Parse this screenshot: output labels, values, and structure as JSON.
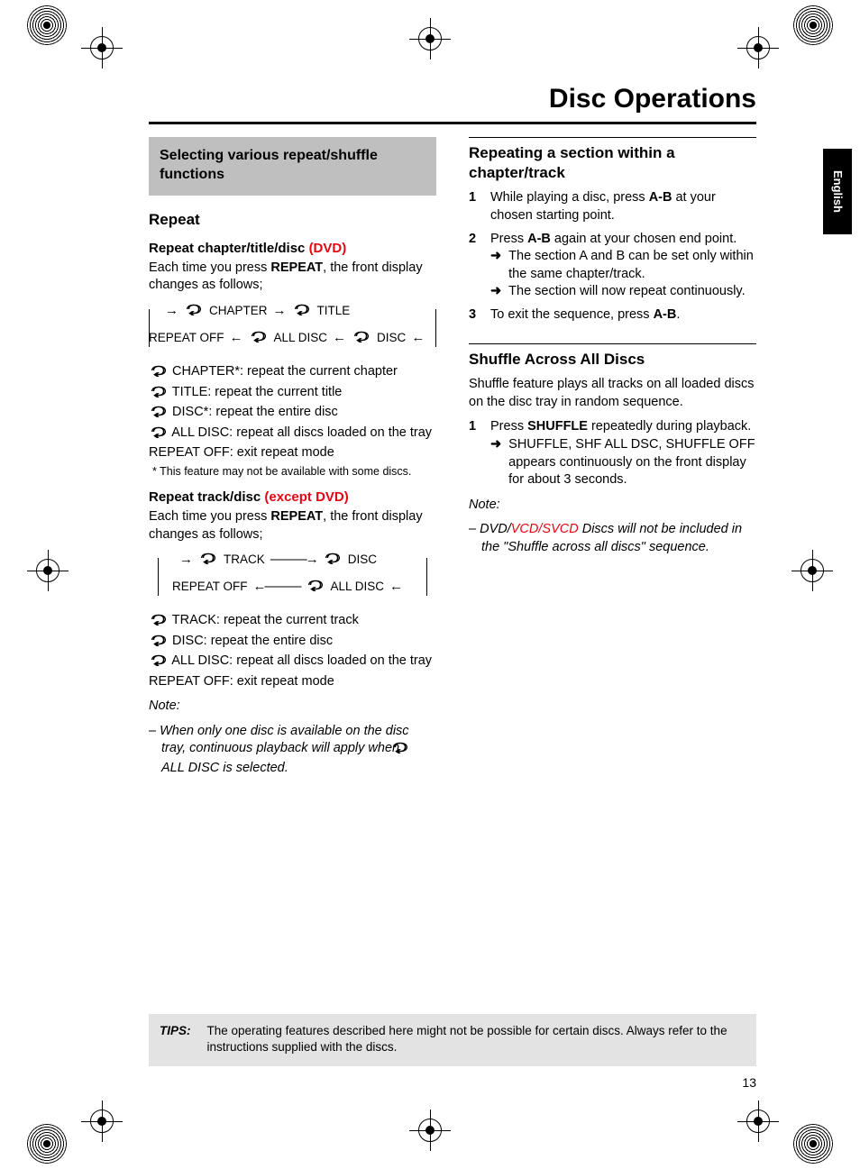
{
  "page_title": "Disc Operations",
  "language_tab": "English",
  "page_number": "13",
  "tips": {
    "label": "TIPS:",
    "text": "The operating features described here might not be possible for certain discs. Always refer to the instructions supplied with the discs."
  },
  "left": {
    "box_heading": "Selecting various repeat/shuffle functions",
    "repeat_heading": "Repeat",
    "dvd": {
      "title_prefix": "Repeat chapter/title/disc ",
      "title_suffix": "(DVD)",
      "intro_a": "Each time you press ",
      "intro_b": "REPEAT",
      "intro_c": ", the front display changes as follows;",
      "seq": {
        "a": "CHAPTER",
        "b": "TITLE",
        "c": "DISC",
        "d": "ALL DISC",
        "e": "REPEAT OFF"
      },
      "defs": {
        "chapter": " CHAPTER*: repeat the current chapter",
        "title": " TITLE: repeat the current title",
        "disc": " DISC*: repeat the entire disc",
        "all": " ALL DISC: repeat all discs loaded on the tray",
        "off": "REPEAT OFF: exit repeat mode"
      },
      "footnote": "*  This feature may not be available with some discs."
    },
    "nondvd": {
      "title_prefix": "Repeat track/disc ",
      "title_suffix": "(except DVD)",
      "intro_a": "Each time you press ",
      "intro_b": "REPEAT",
      "intro_c": ", the front display changes as follows;",
      "seq": {
        "a": "TRACK",
        "b": "DISC",
        "c": "ALL DISC",
        "d": "REPEAT OFF"
      },
      "defs": {
        "track": " TRACK: repeat the current track",
        "disc": " DISC: repeat the entire disc",
        "all": " ALL DISC: repeat all discs loaded on the tray",
        "off": "REPEAT OFF: exit repeat mode"
      },
      "note_label": "Note:",
      "note_body_a": "–   When only one disc is available on the disc tray, continuous playback will apply when ",
      "note_body_b": " ALL DISC is selected."
    }
  },
  "right": {
    "ab": {
      "heading": "Repeating a section within a chapter/track",
      "s1_a": "While playing a disc, press ",
      "s1_b": "A-B",
      "s1_c": " at your chosen starting point.",
      "s2_a": "Press ",
      "s2_b": "A-B",
      "s2_c": " again at your chosen end point.",
      "s2_l1": "The section A and B can be set only within the same chapter/track.",
      "s2_l2": "The section will now repeat continuously.",
      "s3_a": "To exit the sequence, press ",
      "s3_b": "A-B",
      "s3_c": "."
    },
    "shuffle": {
      "heading": "Shuffle Across All Discs",
      "intro": "Shuffle feature plays all tracks on all loaded discs on the disc tray in random sequence.",
      "s1_a": "Press ",
      "s1_b": "SHUFFLE",
      "s1_c": " repeatedly during playback.",
      "s1_l1": "SHUFFLE, SHF ALL DSC, SHUFFLE OFF appears continuously on the front display for about 3 seconds.",
      "note_label": "Note:",
      "note_a": "–   DVD/",
      "note_b": "VCD/SVCD",
      "note_c": " Discs will not be included in the \"Shuffle across all discs\" sequence."
    }
  }
}
